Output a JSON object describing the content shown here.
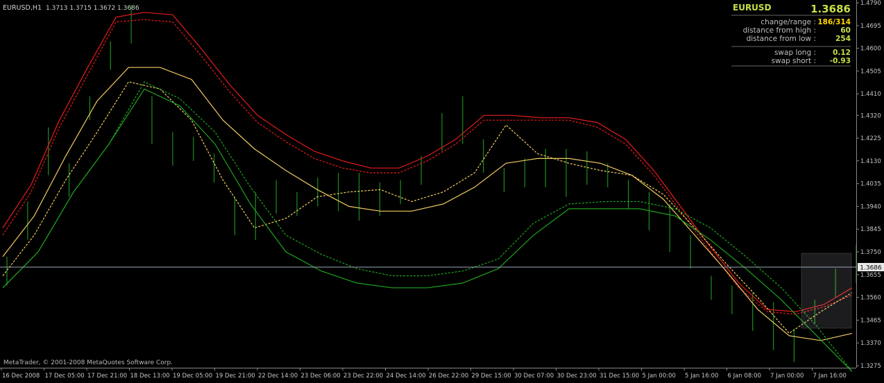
{
  "chart_title": "EURUSD,H1",
  "ohlc_header": "1.3713 1.3715 1.3672 1.3686",
  "copyright": "MetaTrader, © 2001-2008 MetaQuotes Software Corp.",
  "current_price_label": "1.3686",
  "info_panel": {
    "symbol": "EURUSD",
    "price": "1.3686",
    "rows": [
      {
        "label": "change/range :",
        "value": "186/314",
        "color": "#ffd700"
      },
      {
        "label": "distance from high :",
        "value": "60",
        "color": "#c6e048"
      },
      {
        "label": "distance from low :",
        "value": "254",
        "color": "#c6e048"
      },
      {
        "label": "swap long :",
        "value": "0.12",
        "color": "#c6e048"
      },
      {
        "label": "swap short :",
        "value": "-0.93",
        "color": "#c6e048"
      }
    ]
  },
  "colors": {
    "background": "#000000",
    "bars": "#1d8f1d",
    "upper_band": "#e81b1b",
    "upper_band_dashed": "#e81b1b",
    "mid_band": "#f2cc62",
    "lower_band": "#1fa31f",
    "axis_text": "#c8c8c8",
    "price_line": "#b8c8d8",
    "panel_symbol": "#c6e048",
    "panel_label": "#bfbfbf"
  },
  "chart_data": {
    "type": "line",
    "title": "EURUSD,H1",
    "ylim": [
      1.3275,
      1.479
    ],
    "y_ticks": [
      "1.4790",
      "1.4695",
      "1.4600",
      "1.4505",
      "1.4410",
      "1.4320",
      "1.4225",
      "1.4130",
      "1.4035",
      "1.3940",
      "1.3845",
      "1.3750",
      "1.3655",
      "1.3560",
      "1.3465",
      "1.3370",
      "1.3275"
    ],
    "x_ticks": [
      "16 Dec 2008",
      "17 Dec 05:00",
      "17 Dec 21:00",
      "18 Dec 13:00",
      "19 Dec 05:00",
      "19 Dec 21:00",
      "22 Dec 14:00",
      "23 Dec 06:00",
      "23 Dec 22:00",
      "24 Dec 14:00",
      "26 Dec 22:00",
      "29 Dec 15:00",
      "30 Dec 07:00",
      "30 Dec 23:00",
      "31 Dec 15:00",
      "5 Jan 00:00",
      "5 Jan 16:00",
      "6 Jan 08:00",
      "7 Jan 00:00",
      "7 Jan 16:00"
    ],
    "current_price": 1.3686,
    "price_bars": [
      1.367,
      1.388,
      1.417,
      1.405,
      1.435,
      1.457,
      1.47,
      1.43,
      1.418,
      1.418,
      1.41,
      1.39,
      1.39,
      1.398,
      1.395,
      1.4,
      1.4,
      1.398,
      1.397,
      1.4,
      1.409,
      1.425,
      1.43,
      1.415,
      1.405,
      1.408,
      1.41,
      1.408,
      1.41,
      1.407,
      1.399,
      1.392,
      1.385,
      1.375,
      1.36,
      1.355,
      1.35,
      1.344,
      1.336,
      1.35,
      1.362,
      1.37
    ],
    "series": [
      {
        "values": [
          1.385,
          1.403,
          1.43,
          1.452,
          1.473,
          1.475,
          1.474,
          1.46,
          1.445,
          1.432,
          1.424,
          1.417,
          1.413,
          1.41,
          1.41,
          1.415,
          1.422,
          1.432,
          1.432,
          1.431,
          1.431,
          1.429,
          1.422,
          1.409,
          1.393,
          1.377,
          1.362,
          1.351,
          1.35,
          1.353,
          1.36
        ]
      },
      {
        "values": [
          1.382,
          1.4,
          1.427,
          1.449,
          1.471,
          1.472,
          1.471,
          1.457,
          1.442,
          1.429,
          1.421,
          1.414,
          1.41,
          1.408,
          1.408,
          1.413,
          1.42,
          1.43,
          1.43,
          1.43,
          1.43,
          1.427,
          1.42,
          1.407,
          1.391,
          1.375,
          1.36,
          1.35,
          1.349,
          1.352,
          1.357
        ]
      },
      {
        "values": [
          1.373,
          1.39,
          1.415,
          1.438,
          1.452,
          1.452,
          1.447,
          1.43,
          1.418,
          1.409,
          1.401,
          1.394,
          1.392,
          1.392,
          1.395,
          1.402,
          1.412,
          1.414,
          1.414,
          1.412,
          1.407,
          1.397,
          1.382,
          1.367,
          1.351,
          1.34,
          1.338,
          1.341
        ]
      },
      {
        "values": [
          1.365,
          1.382,
          1.405,
          1.425,
          1.446,
          1.443,
          1.43,
          1.405,
          1.385,
          1.389,
          1.398,
          1.4,
          1.401,
          1.396,
          1.4,
          1.408,
          1.428,
          1.416,
          1.412,
          1.409,
          1.407,
          1.399,
          1.385,
          1.37,
          1.356,
          1.341,
          1.35,
          1.358
        ]
      },
      {
        "values": [
          1.36,
          1.375,
          1.4,
          1.42,
          1.446,
          1.439,
          1.425,
          1.402,
          1.382,
          1.374,
          1.368,
          1.365,
          1.365,
          1.367,
          1.372,
          1.387,
          1.395,
          1.396,
          1.396,
          1.393,
          1.385,
          1.373,
          1.36,
          1.344,
          1.325
        ]
      },
      {
        "values": [
          1.36,
          1.375,
          1.4,
          1.42,
          1.443,
          1.436,
          1.42,
          1.395,
          1.375,
          1.367,
          1.362,
          1.36,
          1.36,
          1.362,
          1.368,
          1.382,
          1.393,
          1.393,
          1.393,
          1.39,
          1.38,
          1.368,
          1.355,
          1.34,
          1.325
        ]
      }
    ]
  }
}
